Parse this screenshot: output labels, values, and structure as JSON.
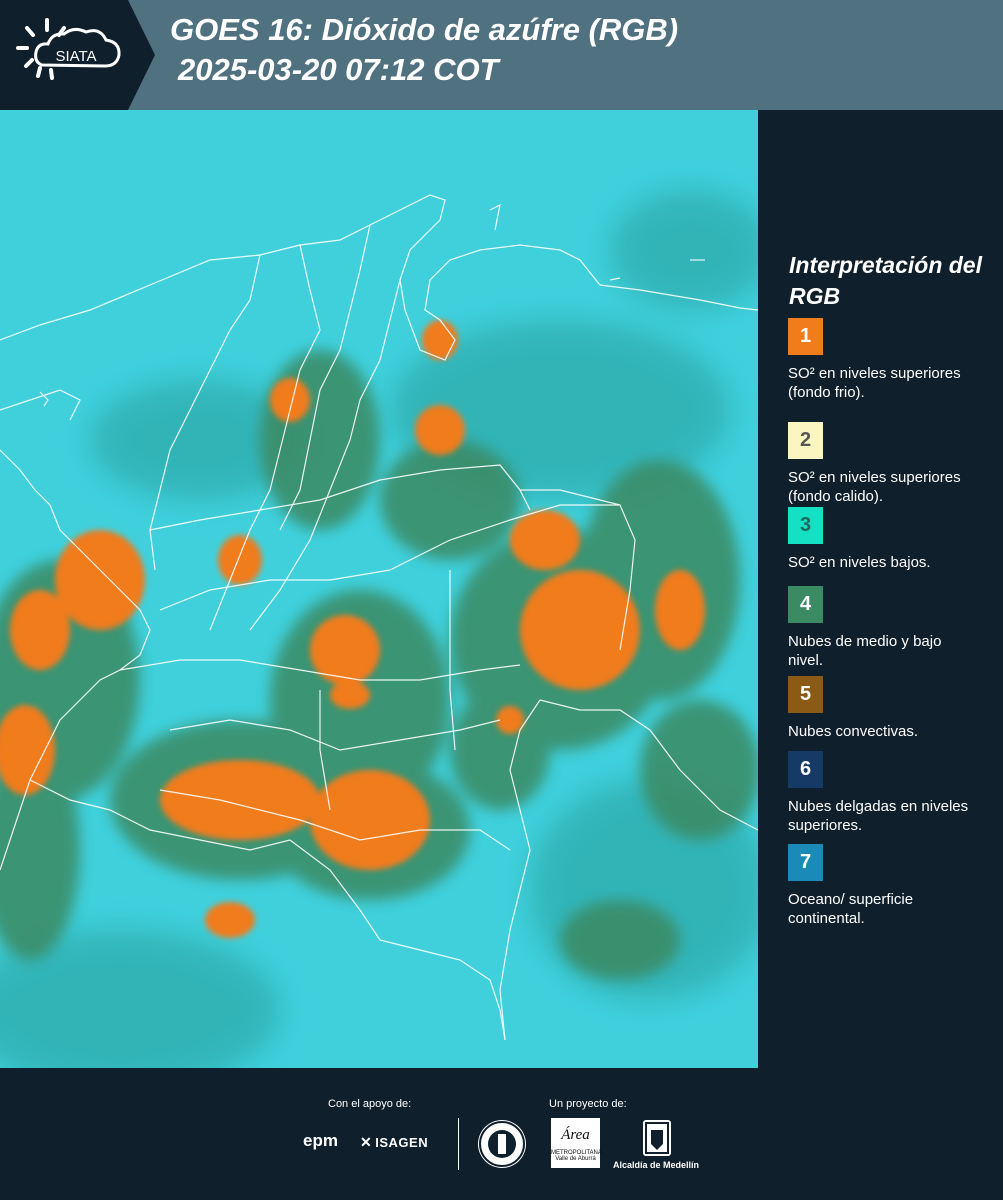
{
  "header": {
    "logo_text": "SIATA",
    "title_line1": "GOES 16: Dióxido de azúfre (RGB)",
    "title_line2": "2025-03-20 07:12 COT"
  },
  "legend": {
    "title": "Interpretación del RGB",
    "items": [
      {
        "number": "1",
        "text": "SO² en niveles superiores (fondo frio).",
        "color": "#f07c1c",
        "number_color": "#ffffff"
      },
      {
        "number": "2",
        "text": "SO² en niveles superiores (fondo calido).",
        "color": "#fbf5c2",
        "number_color": "#555555"
      },
      {
        "number": "3",
        "text": "SO² en niveles bajos.",
        "color": "#16e0c4",
        "number_color": "#1d6a60"
      },
      {
        "number": "4",
        "text": "Nubes de medio y bajo nivel.",
        "color": "#3a8a63",
        "number_color": "#ffffff"
      },
      {
        "number": "5",
        "text": "Nubes convectivas.",
        "color": "#8b5a14",
        "number_color": "#ffffff"
      },
      {
        "number": "6",
        "text": "Nubes delgadas en niveles superiores.",
        "color": "#163a66",
        "number_color": "#ffffff"
      },
      {
        "number": "7",
        "text": "Oceano/ superficie continental.",
        "color": "#1a8ab6",
        "number_color": "#ffffff"
      }
    ]
  },
  "footer": {
    "support_label": "Con el apoyo de:",
    "project_label": "Un proyecto de:",
    "sponsors": [
      "epm",
      "ISAGEN"
    ],
    "partners": {
      "area_logo_text": "Área",
      "area_logo_subtitle": "METROPOLITANA Valle de Aburrá",
      "alcaldia_label": "Alcaldía de Medellín"
    }
  },
  "map": {
    "background_color": "#3fd0dc",
    "cloud_colors": {
      "convective": "#f07c1c",
      "mid_low": "#3a8a63",
      "thin": "#2aa3a0"
    },
    "border_color": "#ffffff"
  }
}
